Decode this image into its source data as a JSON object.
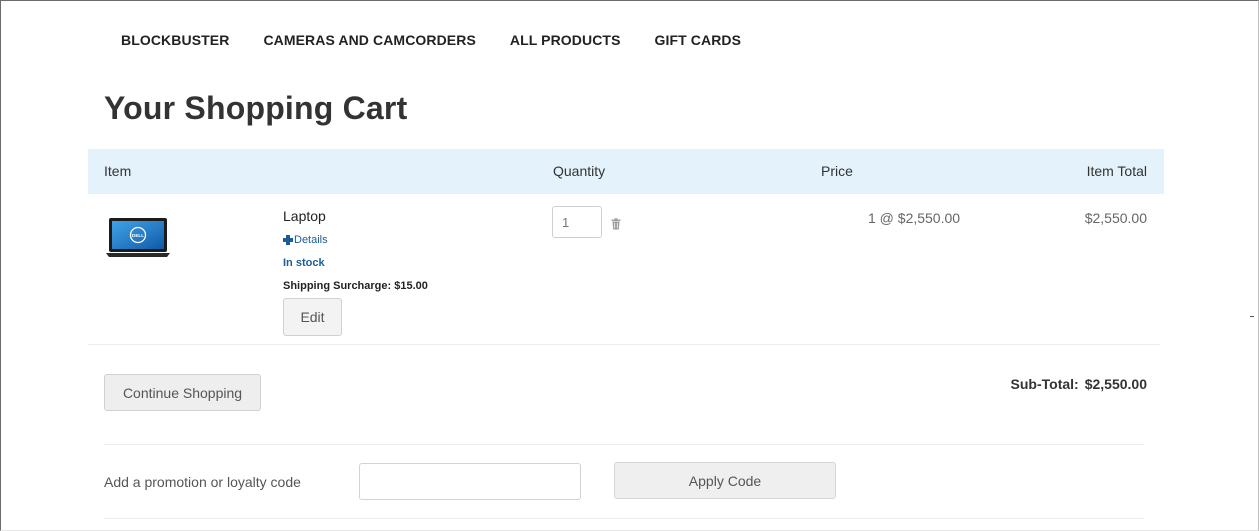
{
  "nav": {
    "items": [
      {
        "label": "BLOCKBUSTER"
      },
      {
        "label": "CAMERAS AND CAMCORDERS"
      },
      {
        "label": "ALL PRODUCTS"
      },
      {
        "label": "GIFT CARDS"
      }
    ]
  },
  "page": {
    "title": "Your Shopping Cart"
  },
  "cart": {
    "columns": {
      "item": "Item",
      "quantity": "Quantity",
      "price": "Price",
      "item_total": "Item Total"
    },
    "items": [
      {
        "name": "Laptop",
        "details_label": "Details",
        "stock_status": "In stock",
        "surcharge": "Shipping Surcharge: $15.00",
        "edit_label": "Edit",
        "quantity": "1",
        "price": "1 @ $2,550.00",
        "total": "$2,550.00",
        "image_logo": "DELL",
        "icons": {
          "details": "plus-icon",
          "remove": "trash-icon",
          "image": "laptop-image"
        }
      }
    ],
    "continue_label": "Continue Shopping",
    "subtotal_label": "Sub-Total:",
    "subtotal_value": "$2,550.00"
  },
  "promo": {
    "label": "Add a promotion or loyalty code",
    "input_value": "",
    "apply_label": "Apply Code"
  },
  "colors": {
    "header_bg": "#e4f2fb",
    "link_blue": "#1d5d97",
    "button_bg": "#eeeeee"
  }
}
